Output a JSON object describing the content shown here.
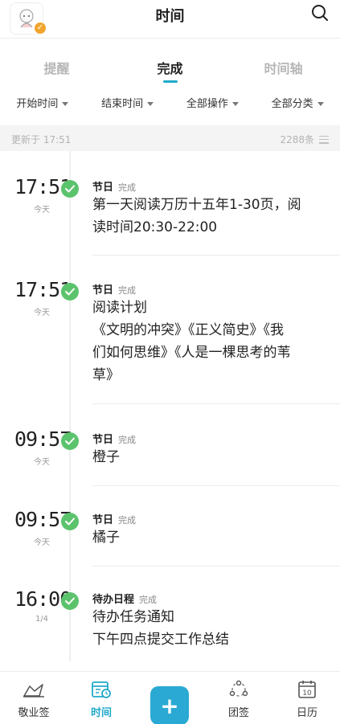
{
  "header": {
    "title": "时间"
  },
  "tabs": [
    {
      "label": "提醒",
      "active": false
    },
    {
      "label": "完成",
      "active": true
    },
    {
      "label": "时间轴",
      "active": false
    }
  ],
  "filters": [
    "开始时间",
    "结束时间",
    "全部操作",
    "全部分类"
  ],
  "status": {
    "updated": "更新于 17:51",
    "count": "2288条"
  },
  "entries": [
    {
      "time": "17:51",
      "sub": "今天",
      "category": "节日",
      "state": "完成",
      "lines": [
        "第一天阅读万历十五年1-30页，阅",
        "读时间20:30-22:00"
      ]
    },
    {
      "time": "17:51",
      "sub": "今天",
      "category": "节日",
      "state": "完成",
      "lines": [
        "阅读计划",
        "《文明的冲突》《正义简史》《我",
        "们如何思维》《人是一棵思考的苇",
        "草》"
      ]
    },
    {
      "time": "09:57",
      "sub": "今天",
      "category": "节日",
      "state": "完成",
      "lines": [
        "橙子"
      ]
    },
    {
      "time": "09:57",
      "sub": "今天",
      "category": "节日",
      "state": "完成",
      "lines": [
        "橘子"
      ]
    },
    {
      "time": "16:00",
      "sub": "1/4",
      "category": "待办日程",
      "state": "完成",
      "lines": [
        "待办任务通知",
        "下午四点提交工作总结"
      ]
    }
  ],
  "bottom_nav": [
    {
      "label": "敬业签",
      "icon": "logo-icon",
      "active": false
    },
    {
      "label": "时间",
      "icon": "calendar-clock-icon",
      "active": true
    },
    {
      "label": "+",
      "icon": "add-icon",
      "active": false
    },
    {
      "label": "团签",
      "icon": "team-icon",
      "active": false
    },
    {
      "label": "日历",
      "icon": "calendar-icon",
      "active": false
    }
  ],
  "calendar_icon_day": "10",
  "colors": {
    "accent": "#20a9c9",
    "check": "#5cc36d",
    "fab": "#2aa9d4"
  }
}
